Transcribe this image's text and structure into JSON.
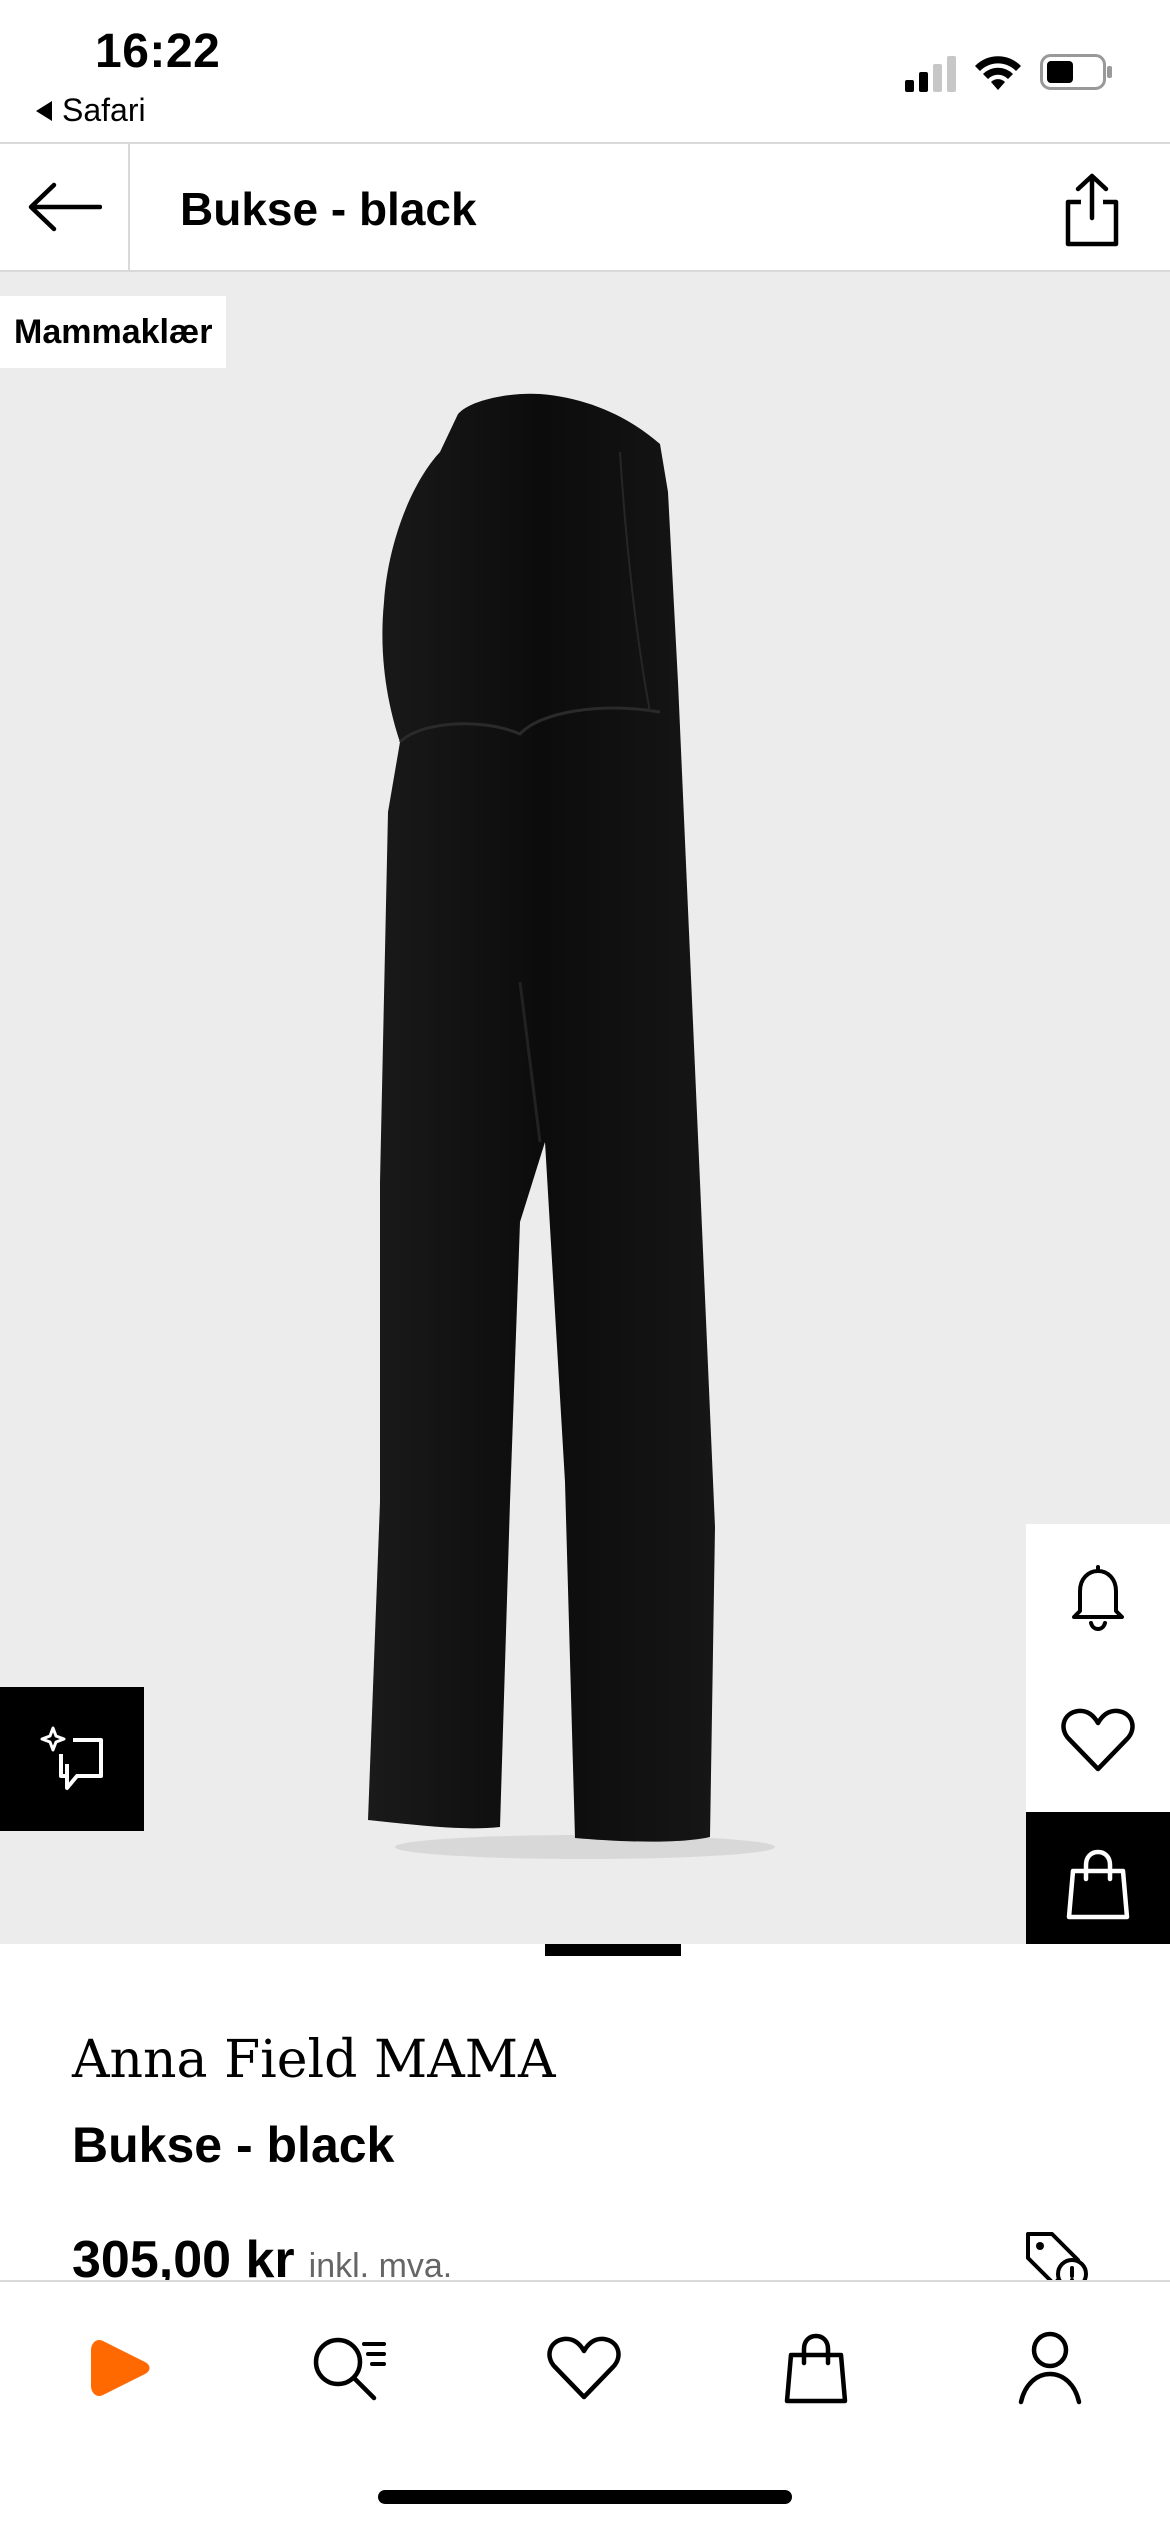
{
  "status_bar": {
    "time": "16:22",
    "back_app": "Safari"
  },
  "header": {
    "title": "Bukse - black",
    "back_icon": "arrow-left-icon",
    "share_icon": "share-icon"
  },
  "product_image": {
    "category_tag": "Mammaklær",
    "ai_button_icon": "sparkle-chat-icon",
    "side_actions": [
      {
        "name": "bell-icon"
      },
      {
        "name": "heart-icon"
      },
      {
        "name": "bag-icon"
      }
    ]
  },
  "product": {
    "brand": "Anna Field MAMA",
    "name": "Bukse - black",
    "price": "305,00 kr",
    "vat_note": "inkl. mva."
  },
  "colors": {
    "accent": "#ff6900",
    "image_background": "#ececec",
    "divider": "#d9d9d9"
  },
  "bottom_nav": [
    {
      "name": "home",
      "icon": "zalando-logo-icon"
    },
    {
      "name": "search",
      "icon": "search-list-icon"
    },
    {
      "name": "wishlist",
      "icon": "heart-icon"
    },
    {
      "name": "bag",
      "icon": "bag-icon"
    },
    {
      "name": "profile",
      "icon": "person-icon"
    }
  ]
}
